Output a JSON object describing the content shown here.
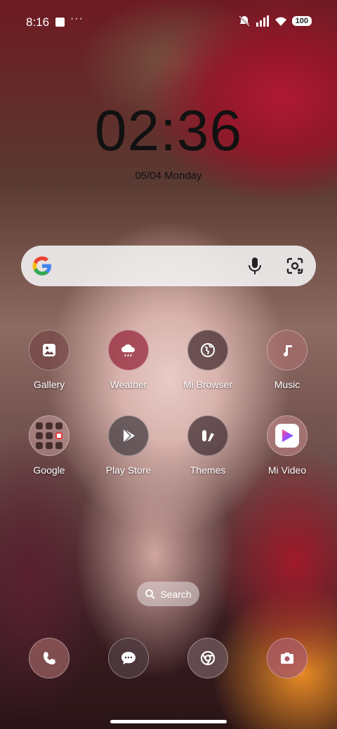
{
  "status_bar": {
    "time": "8:16",
    "more": "···",
    "battery": "100"
  },
  "clock": {
    "time": "02:36",
    "date": "05/04 Monday"
  },
  "search_bar": {
    "google_letter": "G"
  },
  "apps_row1": [
    {
      "label": "Gallery",
      "icon": "gallery-icon"
    },
    {
      "label": "Weather",
      "icon": "weather-icon"
    },
    {
      "label": "Mi Browser",
      "icon": "globe-icon"
    },
    {
      "label": "Music",
      "icon": "music-icon"
    }
  ],
  "apps_row2": [
    {
      "label": "Google",
      "icon": "folder-icon"
    },
    {
      "label": "Play Store",
      "icon": "play-store-icon"
    },
    {
      "label": "Themes",
      "icon": "themes-icon"
    },
    {
      "label": "Mi Video",
      "icon": "mi-video-icon"
    }
  ],
  "app_search": {
    "label": "Search"
  },
  "dock": [
    {
      "icon": "phone-icon"
    },
    {
      "icon": "messages-icon"
    },
    {
      "icon": "chrome-icon"
    },
    {
      "icon": "camera-icon"
    }
  ],
  "colors": {
    "google_blue": "#4285F4",
    "google_red": "#EA4335",
    "google_yellow": "#FBBC05",
    "google_green": "#34A853"
  }
}
